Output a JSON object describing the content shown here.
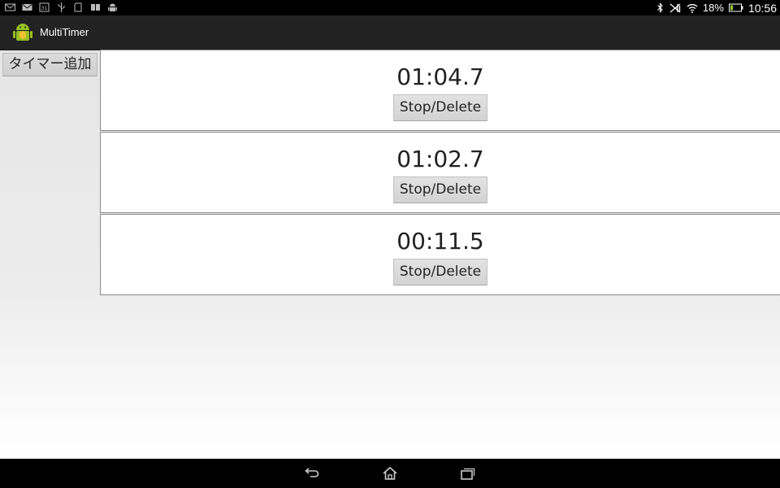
{
  "status_bar": {
    "notifications": [
      "gmail-icon",
      "mail-icon",
      "calendar-icon",
      "usb-icon",
      "sd-card-icon",
      "book-icon",
      "android-debug-icon"
    ],
    "battery_percent": "18%",
    "time": "10:56"
  },
  "action_bar": {
    "title": "MultiTimer"
  },
  "add_timer_label": "タイマー追加",
  "timers": [
    {
      "time": "01:04.7",
      "button_label": "Stop/Delete"
    },
    {
      "time": "01:02.7",
      "button_label": "Stop/Delete"
    },
    {
      "time": "00:11.5",
      "button_label": "Stop/Delete"
    }
  ],
  "nav_bar": {
    "buttons": [
      "back-icon",
      "home-icon",
      "recents-icon"
    ]
  }
}
